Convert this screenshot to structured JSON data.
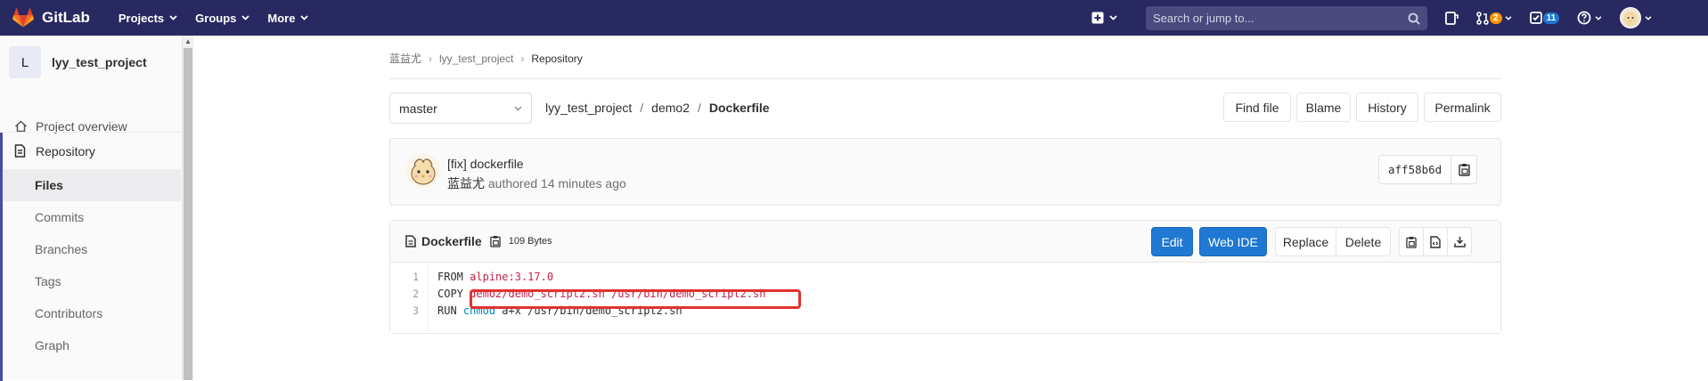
{
  "navbar": {
    "brand": "GitLab",
    "menu": [
      {
        "label": "Projects"
      },
      {
        "label": "Groups"
      },
      {
        "label": "More"
      }
    ],
    "search_placeholder": "Search or jump to...",
    "merge_requests_count": "2",
    "todos_count": "11",
    "colors": {
      "background": "#292961",
      "accent": "#fc6d26"
    }
  },
  "sidebar": {
    "project_letter": "L",
    "project_name": "lyy_test_project",
    "overview_label": "Project overview",
    "repository_label": "Repository",
    "sub_items": [
      {
        "label": "Files",
        "active": true
      },
      {
        "label": "Commits"
      },
      {
        "label": "Branches"
      },
      {
        "label": "Tags"
      },
      {
        "label": "Contributors"
      },
      {
        "label": "Graph"
      }
    ]
  },
  "breadcrumb": {
    "items": [
      "蓝益尤",
      "lyy_test_project",
      "Repository"
    ]
  },
  "file_nav": {
    "branch": "master",
    "path": [
      "lyy_test_project",
      "demo2",
      "Dockerfile"
    ],
    "separator": "/",
    "buttons": {
      "find_file": "Find file",
      "blame": "Blame",
      "history": "History",
      "permalink": "Permalink"
    }
  },
  "commit": {
    "title": "[fix] dockerfile",
    "author": "蓝益尤",
    "meta": "authored 14 minutes ago",
    "sha": "aff58b6d"
  },
  "file": {
    "name": "Dockerfile",
    "size": "109 Bytes",
    "buttons": {
      "edit": "Edit",
      "web_ide": "Web IDE",
      "replace": "Replace",
      "delete": "Delete"
    },
    "lines": [
      {
        "num": "1",
        "keyword": "FROM",
        "args": [
          {
            "text": "alpine:3.17.0",
            "type": "str"
          }
        ]
      },
      {
        "num": "2",
        "keyword": "COPY",
        "args": [
          {
            "text": "demo2/demo_script2.sh /usr/bin/demo_script2.sh",
            "type": "str"
          }
        ]
      },
      {
        "num": "3",
        "keyword": "RUN",
        "args": [
          {
            "text": "chmod",
            "type": "fn"
          },
          {
            "text": " a+x /usr/bin/demo_script2.sh",
            "type": "plain"
          }
        ]
      }
    ]
  }
}
